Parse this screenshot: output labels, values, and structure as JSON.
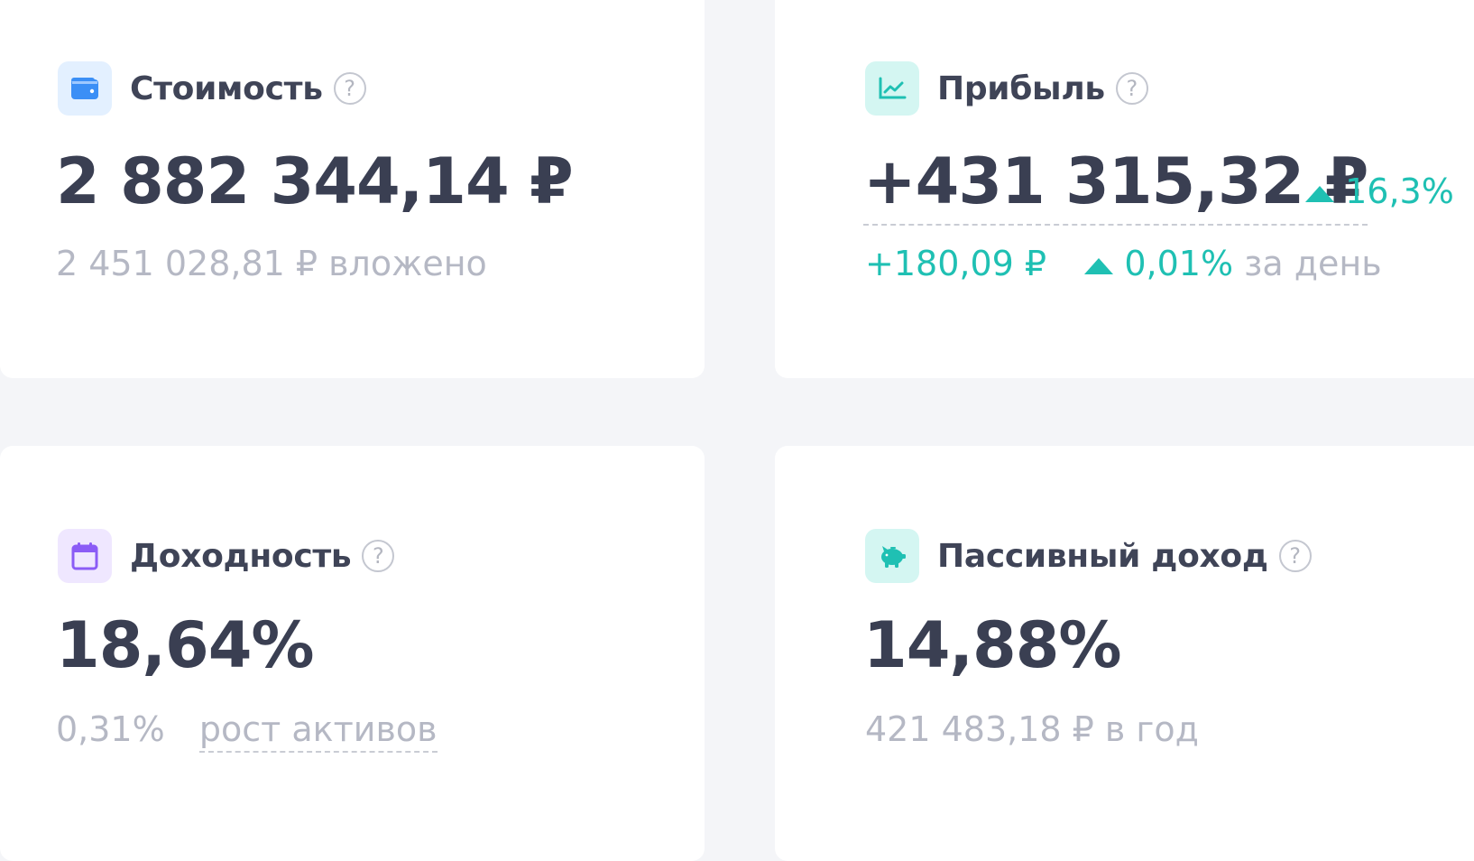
{
  "colors": {
    "accent_green": "#1fc0b3",
    "text_main": "#3a3f52",
    "text_muted": "#b5b8c4",
    "icon_blue": "#3b8ff6",
    "icon_purple": "#8b5cf6",
    "icon_teal": "#1fc0b3"
  },
  "value_card": {
    "icon": "wallet-icon",
    "title": "Стоимость",
    "help": "?",
    "amount": "2 882 344,14 ₽",
    "invested": "2 451 028,81 ₽ вложено"
  },
  "profit_card": {
    "icon": "chart-line-icon",
    "title": "Прибыль",
    "help": "?",
    "amount": "+431 315,32 ₽",
    "change_pct": "16,3%",
    "day_amount": "+180,09 ₽",
    "day_pct": "0,01%",
    "day_label": "за день"
  },
  "yield_card": {
    "icon": "calendar-icon",
    "title": "Доходность",
    "help": "?",
    "percent": "18,64%",
    "growth_pct": "0,31%",
    "growth_label": "рост активов"
  },
  "passive_card": {
    "icon": "piggy-bank-icon",
    "title": "Пассивный доход",
    "help": "?",
    "percent": "14,88%",
    "per_year": "421 483,18 ₽ в год"
  }
}
